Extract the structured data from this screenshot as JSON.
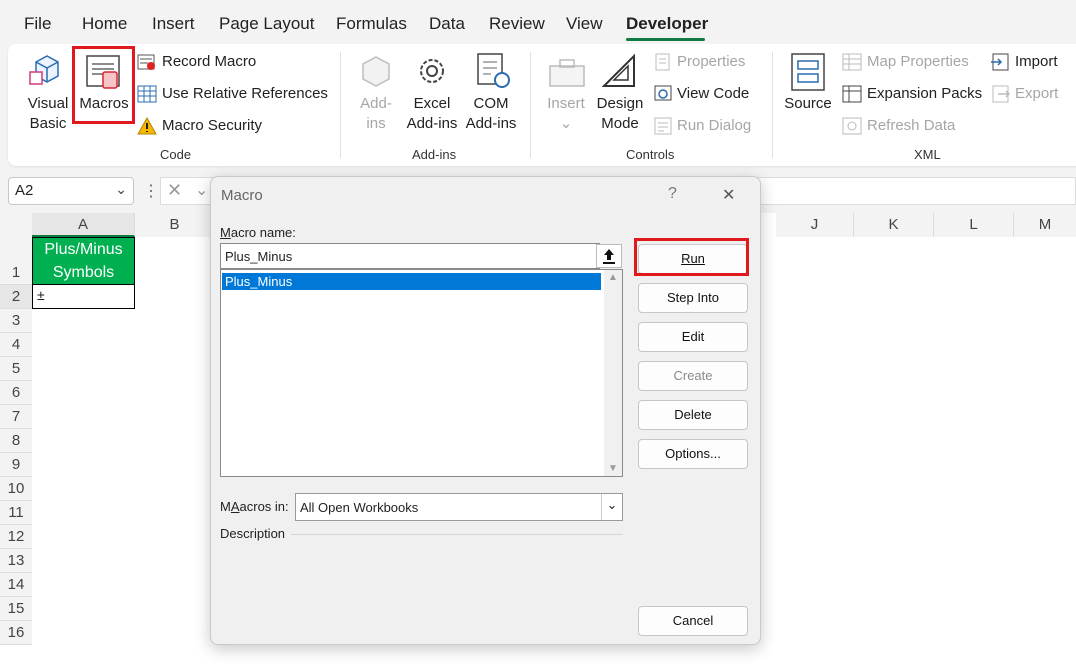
{
  "menu": {
    "tabs": [
      {
        "label": "File"
      },
      {
        "label": "Home"
      },
      {
        "label": "Insert"
      },
      {
        "label": "Page Layout"
      },
      {
        "label": "Formulas"
      },
      {
        "label": "Data"
      },
      {
        "label": "Review"
      },
      {
        "label": "View"
      },
      {
        "label": "Developer"
      }
    ],
    "active_tab": "Developer"
  },
  "ribbon": {
    "code": {
      "visual_basic": "Visual\nBasic",
      "macros": "Macros",
      "record_macro": "Record Macro",
      "use_relative": "Use Relative References",
      "macro_security": "Macro Security",
      "group_label": "Code"
    },
    "addins": {
      "addins": "Add-\nins",
      "excel_addins": "Excel\nAdd-ins",
      "com_addins": "COM\nAdd-ins",
      "group_label": "Add-ins"
    },
    "controls": {
      "insert": "Insert",
      "design_mode": "Design\nMode",
      "properties": "Properties",
      "view_code": "View Code",
      "run_dialog": "Run Dialog",
      "group_label": "Controls"
    },
    "xml": {
      "source": "Source",
      "map_properties": "Map Properties",
      "expansion_packs": "Expansion Packs",
      "refresh_data": "Refresh Data",
      "import": "Import",
      "export": "Export",
      "group_label": "XML"
    }
  },
  "namebox": {
    "value": "A2"
  },
  "columns": [
    "A",
    "B",
    "J",
    "K",
    "L",
    "M"
  ],
  "rows": [
    "1",
    "2",
    "3",
    "4",
    "5",
    "6",
    "7",
    "8",
    "9",
    "10",
    "11",
    "12",
    "13",
    "14",
    "15",
    "16"
  ],
  "cells": {
    "a1": "Plus/Minus\nSymbols",
    "a2": "±"
  },
  "colors": {
    "header_fill": "#00b050",
    "highlight": "#e0191f",
    "selection": "#0078d7",
    "accent": "#107c41"
  },
  "dialog": {
    "title": "Macro",
    "help": "?",
    "close": "✕",
    "macro_name_label_key": "M",
    "macro_name_label_rest": "acro name:",
    "macro_name_value": "Plus_Minus",
    "list_items": [
      "Plus_Minus"
    ],
    "macros_in_label_key": "A",
    "macros_in_label_pre": "M",
    "macros_in_label_rest": "acros in:",
    "macros_in_value": "All Open Workbooks",
    "description_label": "Description",
    "buttons": {
      "run": "Run",
      "step_into": "Step Into",
      "edit": "Edit",
      "create": "Create",
      "delete": "Delete",
      "options": "Options...",
      "cancel": "Cancel"
    }
  }
}
